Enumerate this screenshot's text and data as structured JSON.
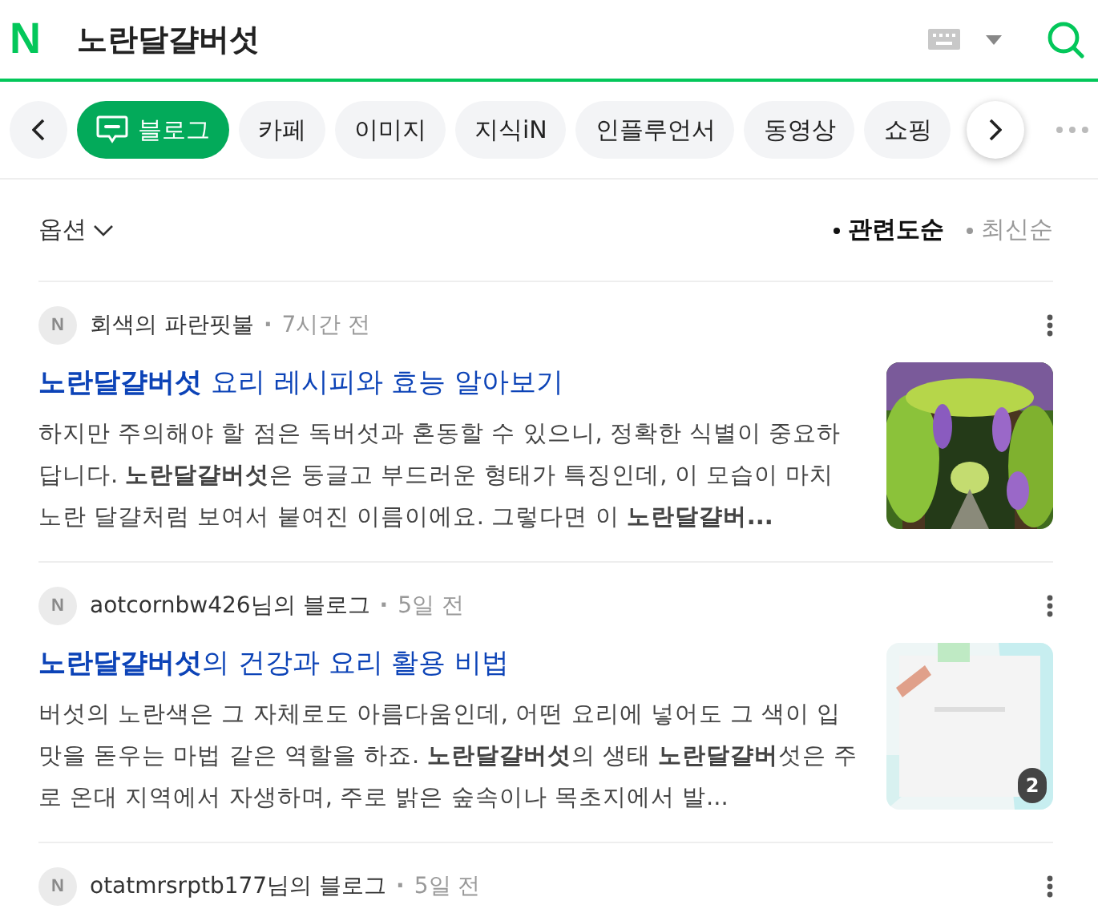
{
  "header": {
    "logo": "N",
    "query": "노란달걀버섯"
  },
  "tabs": [
    {
      "label": "블로그",
      "selected": true,
      "kind": "blog"
    },
    {
      "label": "카페",
      "selected": false
    },
    {
      "label": "이미지",
      "selected": false
    },
    {
      "label": "지식iN",
      "selected": false
    },
    {
      "label": "인플루언서",
      "selected": false
    },
    {
      "label": "동영상",
      "selected": false
    },
    {
      "label": "쇼핑",
      "selected": false
    }
  ],
  "options": {
    "label": "옵션",
    "sorts": [
      {
        "label": "관련도순",
        "selected": true
      },
      {
        "label": "최신순",
        "selected": false
      }
    ]
  },
  "posts": [
    {
      "avatar_letter": "N",
      "source": "회색의 파란핏불",
      "separator": "·",
      "time": "7시간 전",
      "title": "**노란달걀버섯** 요리 레시피와 효능 알아보기",
      "snippet": "하지만 주의해야 할 점은 독버섯과 혼동할 수 있으니, 정확한 식별이 중요하답니다. **노란달걀버섯**은 둥글고 부드러운 형태가 특징인데, 이 모습이 마치 노란 달걀처럼 보여서 붙여진 이름이에요. 그렇다면 이 **노란달걀버...**",
      "thumbnail": {
        "kind": "garden"
      }
    },
    {
      "avatar_letter": "N",
      "source": "aotcornbw426님의 블로그",
      "separator": "·",
      "time": "5일 전",
      "title": "**노란달걀버섯**의 건강과 요리 활용 비법",
      "snippet": "버섯의 노란색은 그 자체로도 아름다움인데, 어떤 요리에 넣어도 그 색이 입맛을 돋우는 마법 같은 역할을 하죠. **노란달걀버섯**의 생태 **노란달걀버**섯은 주로 온대 지역에서 자생하며, 주로 밝은 숲속이나 목초지에서 발...",
      "thumbnail": {
        "kind": "card",
        "count": "2"
      }
    },
    {
      "avatar_letter": "N",
      "source": "otatmrsrptb177님의 블로그",
      "separator": "·",
      "time": "5일 전"
    }
  ]
}
